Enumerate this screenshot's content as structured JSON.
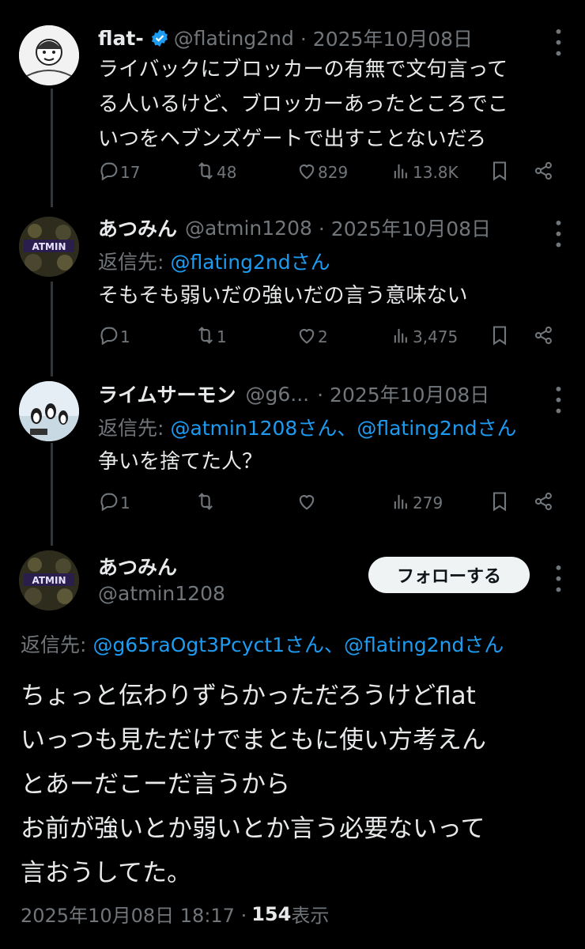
{
  "tweets": [
    {
      "name": "flat-",
      "handle": "@flating2nd",
      "date": "· 2025年10月08日",
      "lines": [
        "ライバックにブロッカーの有無で文句言って",
        "る人いるけど、ブロッカーあったところでこ",
        "いつをヘブンズゲートで出すことないだろ"
      ],
      "replies": "17",
      "retweets": "48",
      "likes": "829",
      "views": "13.8K"
    },
    {
      "name": "あつみん",
      "handle": "@atmin1208",
      "date": "· 2025年10月08日",
      "reply_label": "返信先:",
      "reply_targets": "@flating2ndさん",
      "lines": [
        "そもそも弱いだの強いだの言う意味ない"
      ],
      "replies": "1",
      "retweets": "1",
      "likes": "2",
      "views": "3,475"
    },
    {
      "name": "ライムサーモン",
      "handle": "@g6...",
      "date": "· 2025年10月08日",
      "reply_label": "返信先:",
      "reply_targets": "@atmin1208さん、@flating2ndさん",
      "lines": [
        "争いを捨てた人？"
      ],
      "replies": "1",
      "retweets": "",
      "likes": "",
      "views": "279"
    }
  ],
  "main": {
    "name": "あつみん",
    "handle": "@atmin1208",
    "follow_label": "フォローする",
    "reply_label": "返信先:",
    "reply_targets": "@g65raOgt3Pcyct1さん、@flating2ndさん",
    "lines": [
      "ちょっと伝わりずらかっただろうけどflat",
      "いっつも見ただけでまともに使い方考えん",
      "とあーだこーだ言うから",
      "お前が強いとか弱いとか言う必要ないって",
      "言おうしてた。"
    ],
    "timestamp": "2025年10月08日 18:17 · ",
    "view_count": "154",
    "view_label": " 表示"
  },
  "avatar_text": "ATMIN",
  "colors": {
    "accent": "#1d9bf0",
    "muted": "#71767b",
    "verified": "#1d9bf0"
  }
}
